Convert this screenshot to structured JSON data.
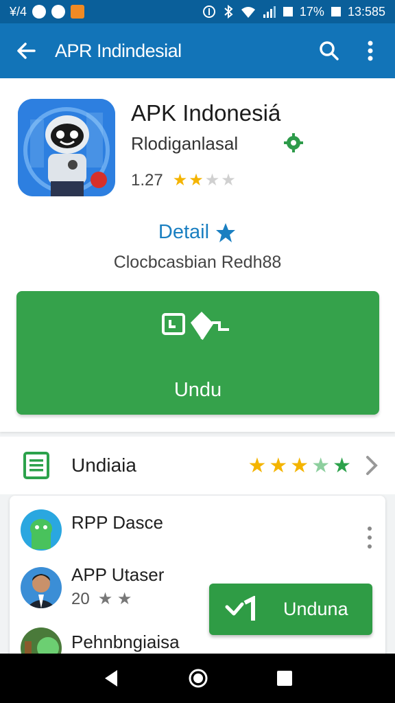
{
  "status_bar": {
    "left_text": "¥/4",
    "battery_pct": "17%",
    "time": "13:585"
  },
  "app_bar": {
    "title": "APR Indindesial",
    "icons": [
      "back-arrow-icon",
      "search-icon",
      "more-vertical-icon"
    ]
  },
  "header": {
    "app_name": "APK Indonesiá",
    "developer": "Rlodiganlasal",
    "rating_value": "1.27",
    "rating_stars": 2,
    "rating_max": 4
  },
  "detail": {
    "link_label": "Detail",
    "subtitle": "Clocbcasbian Redh88"
  },
  "download_button": {
    "label": "Undu"
  },
  "section": {
    "label": "Undiaia",
    "stars": 5
  },
  "list": {
    "items": [
      {
        "title": "RPP Dasce",
        "sub": ""
      },
      {
        "title": "APP Utaser",
        "sub": "20"
      },
      {
        "title": "Pehnbngiaisa",
        "sub": ""
      }
    ]
  },
  "floating_button": {
    "label": "Unduna"
  },
  "colors": {
    "primary": "#1274b8",
    "status_bar": "#0a5f9a",
    "green": "#35a24b",
    "star": "#f4b400",
    "link": "#1a7fc1"
  }
}
